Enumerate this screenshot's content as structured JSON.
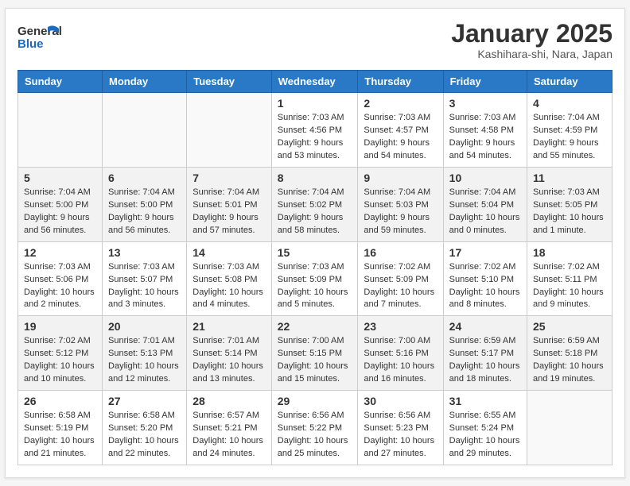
{
  "header": {
    "logo_line1": "General",
    "logo_line2": "Blue",
    "title": "January 2025",
    "subtitle": "Kashihara-shi, Nara, Japan"
  },
  "weekdays": [
    "Sunday",
    "Monday",
    "Tuesday",
    "Wednesday",
    "Thursday",
    "Friday",
    "Saturday"
  ],
  "weeks": [
    [
      {
        "day": "",
        "info": ""
      },
      {
        "day": "",
        "info": ""
      },
      {
        "day": "",
        "info": ""
      },
      {
        "day": "1",
        "info": "Sunrise: 7:03 AM\nSunset: 4:56 PM\nDaylight: 9 hours and 53 minutes."
      },
      {
        "day": "2",
        "info": "Sunrise: 7:03 AM\nSunset: 4:57 PM\nDaylight: 9 hours and 54 minutes."
      },
      {
        "day": "3",
        "info": "Sunrise: 7:03 AM\nSunset: 4:58 PM\nDaylight: 9 hours and 54 minutes."
      },
      {
        "day": "4",
        "info": "Sunrise: 7:04 AM\nSunset: 4:59 PM\nDaylight: 9 hours and 55 minutes."
      }
    ],
    [
      {
        "day": "5",
        "info": "Sunrise: 7:04 AM\nSunset: 5:00 PM\nDaylight: 9 hours and 56 minutes."
      },
      {
        "day": "6",
        "info": "Sunrise: 7:04 AM\nSunset: 5:00 PM\nDaylight: 9 hours and 56 minutes."
      },
      {
        "day": "7",
        "info": "Sunrise: 7:04 AM\nSunset: 5:01 PM\nDaylight: 9 hours and 57 minutes."
      },
      {
        "day": "8",
        "info": "Sunrise: 7:04 AM\nSunset: 5:02 PM\nDaylight: 9 hours and 58 minutes."
      },
      {
        "day": "9",
        "info": "Sunrise: 7:04 AM\nSunset: 5:03 PM\nDaylight: 9 hours and 59 minutes."
      },
      {
        "day": "10",
        "info": "Sunrise: 7:04 AM\nSunset: 5:04 PM\nDaylight: 10 hours and 0 minutes."
      },
      {
        "day": "11",
        "info": "Sunrise: 7:03 AM\nSunset: 5:05 PM\nDaylight: 10 hours and 1 minute."
      }
    ],
    [
      {
        "day": "12",
        "info": "Sunrise: 7:03 AM\nSunset: 5:06 PM\nDaylight: 10 hours and 2 minutes."
      },
      {
        "day": "13",
        "info": "Sunrise: 7:03 AM\nSunset: 5:07 PM\nDaylight: 10 hours and 3 minutes."
      },
      {
        "day": "14",
        "info": "Sunrise: 7:03 AM\nSunset: 5:08 PM\nDaylight: 10 hours and 4 minutes."
      },
      {
        "day": "15",
        "info": "Sunrise: 7:03 AM\nSunset: 5:09 PM\nDaylight: 10 hours and 5 minutes."
      },
      {
        "day": "16",
        "info": "Sunrise: 7:02 AM\nSunset: 5:09 PM\nDaylight: 10 hours and 7 minutes."
      },
      {
        "day": "17",
        "info": "Sunrise: 7:02 AM\nSunset: 5:10 PM\nDaylight: 10 hours and 8 minutes."
      },
      {
        "day": "18",
        "info": "Sunrise: 7:02 AM\nSunset: 5:11 PM\nDaylight: 10 hours and 9 minutes."
      }
    ],
    [
      {
        "day": "19",
        "info": "Sunrise: 7:02 AM\nSunset: 5:12 PM\nDaylight: 10 hours and 10 minutes."
      },
      {
        "day": "20",
        "info": "Sunrise: 7:01 AM\nSunset: 5:13 PM\nDaylight: 10 hours and 12 minutes."
      },
      {
        "day": "21",
        "info": "Sunrise: 7:01 AM\nSunset: 5:14 PM\nDaylight: 10 hours and 13 minutes."
      },
      {
        "day": "22",
        "info": "Sunrise: 7:00 AM\nSunset: 5:15 PM\nDaylight: 10 hours and 15 minutes."
      },
      {
        "day": "23",
        "info": "Sunrise: 7:00 AM\nSunset: 5:16 PM\nDaylight: 10 hours and 16 minutes."
      },
      {
        "day": "24",
        "info": "Sunrise: 6:59 AM\nSunset: 5:17 PM\nDaylight: 10 hours and 18 minutes."
      },
      {
        "day": "25",
        "info": "Sunrise: 6:59 AM\nSunset: 5:18 PM\nDaylight: 10 hours and 19 minutes."
      }
    ],
    [
      {
        "day": "26",
        "info": "Sunrise: 6:58 AM\nSunset: 5:19 PM\nDaylight: 10 hours and 21 minutes."
      },
      {
        "day": "27",
        "info": "Sunrise: 6:58 AM\nSunset: 5:20 PM\nDaylight: 10 hours and 22 minutes."
      },
      {
        "day": "28",
        "info": "Sunrise: 6:57 AM\nSunset: 5:21 PM\nDaylight: 10 hours and 24 minutes."
      },
      {
        "day": "29",
        "info": "Sunrise: 6:56 AM\nSunset: 5:22 PM\nDaylight: 10 hours and 25 minutes."
      },
      {
        "day": "30",
        "info": "Sunrise: 6:56 AM\nSunset: 5:23 PM\nDaylight: 10 hours and 27 minutes."
      },
      {
        "day": "31",
        "info": "Sunrise: 6:55 AM\nSunset: 5:24 PM\nDaylight: 10 hours and 29 minutes."
      },
      {
        "day": "",
        "info": ""
      }
    ]
  ]
}
